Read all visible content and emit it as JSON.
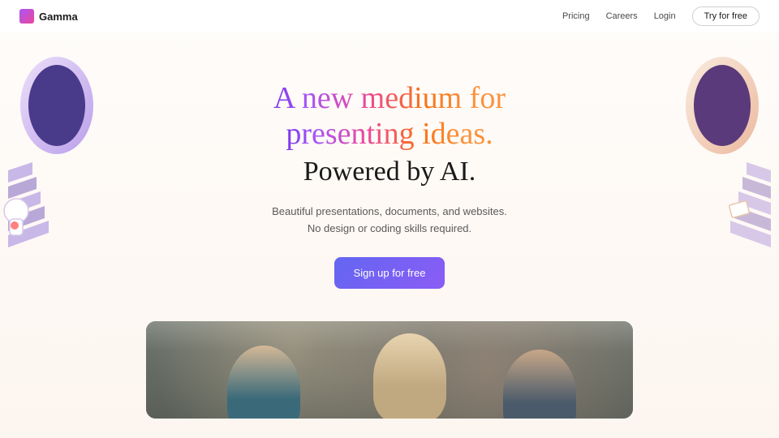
{
  "brand": {
    "name": "Gamma"
  },
  "nav": {
    "pricing": "Pricing",
    "careers": "Careers",
    "login": "Login",
    "try": "Try for free"
  },
  "hero": {
    "headline_line1": "A new medium for",
    "headline_line2": "presenting ideas.",
    "headline_sub": "Powered by AI.",
    "subtitle_line1": "Beautiful presentations, documents, and websites.",
    "subtitle_line2": "No design or coding skills required.",
    "cta": "Sign up for free"
  }
}
